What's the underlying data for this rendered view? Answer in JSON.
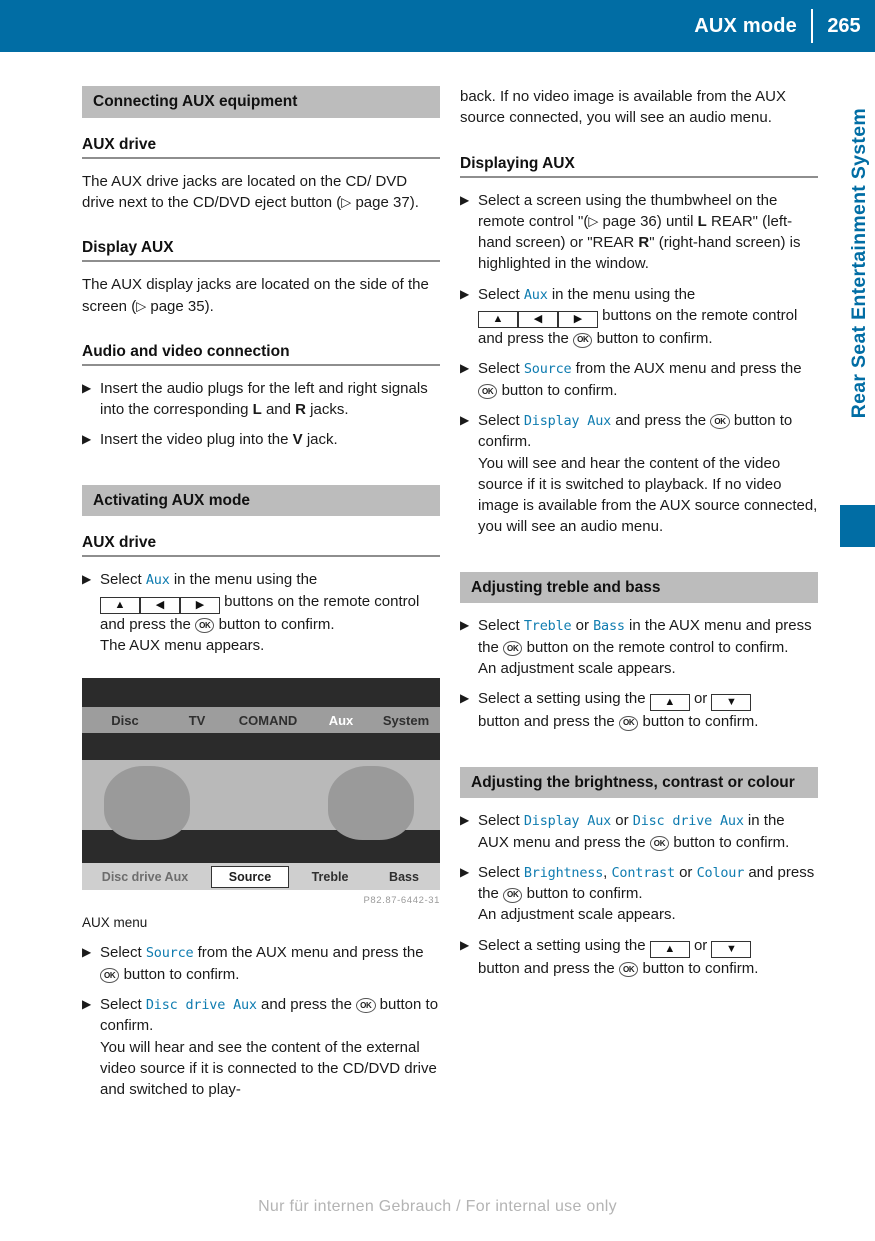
{
  "header": {
    "title": "AUX mode",
    "page_number": "265"
  },
  "sidebar": {
    "chapter_label": "Rear Seat Entertainment System"
  },
  "footer": {
    "text": "Nur für internen Gebrauch / For internal use only"
  },
  "left_column": {
    "section1_heading": "Connecting AUX equipment",
    "sub1_heading": "AUX drive",
    "sub1_para_a": "The AUX drive jacks are located on the CD/ DVD drive next to the CD/DVD eject button (",
    "sub1_para_ref": "page 37",
    "sub1_para_b": ").",
    "sub2_heading": "Display AUX",
    "sub2_para_a": "The AUX display jacks are located on the side of the screen (",
    "sub2_para_ref": "page 35",
    "sub2_para_b": ").",
    "sub3_heading": "Audio and video connection",
    "step1_a": "Insert the audio plugs for the left and right signals into the corresponding ",
    "step1_L": "L",
    "step1_b": " and ",
    "step1_R": "R",
    "step1_c": " jacks.",
    "step2_a": "Insert the video plug into the ",
    "step2_V": "V",
    "step2_b": " jack.",
    "section2_heading": "Activating AUX mode",
    "sub4_heading": "AUX drive",
    "step3_a": "Select ",
    "step3_aux": "Aux",
    "step3_b": " in the menu using the",
    "step3_c": " buttons on the remote control and press the ",
    "step3_d": " button to confirm.",
    "step3_e": "The AUX menu appears.",
    "figure": {
      "top_menu": [
        "Disc",
        "TV",
        "COMAND",
        "Aux",
        "System"
      ],
      "selected_top": "Aux",
      "bottom_menu": [
        "Disc drive Aux",
        "Source",
        "Treble",
        "Bass"
      ],
      "selected_bottom": "Source",
      "code": "P82.87-6442-31",
      "caption": "AUX menu"
    },
    "step4_a": "Select ",
    "step4_src": "Source",
    "step4_b": " from the AUX menu and press the ",
    "step4_c": " button to confirm.",
    "step5_a": "Select ",
    "step5_cmd": "Disc drive Aux",
    "step5_b": " and press the ",
    "step5_c": " button to confirm.",
    "step5_d": "You will hear and see the content of the external video source if it is connected to the CD/DVD drive and switched to play-"
  },
  "right_column": {
    "cont_para": "back. If no video image is available from the AUX source connected, you will see an audio menu.",
    "sub5_heading": "Displaying AUX",
    "step6_a": "Select a screen using the thumbwheel on the remote control \"(",
    "step6_ref": "page 36",
    "step6_b": ") until ",
    "step6_L": "L",
    "step6_c": " REAR\" (left-hand screen) or \"REAR ",
    "step6_R": "R",
    "step6_d": "\" (right-hand screen) is highlighted in the window.",
    "step7_a": "Select ",
    "step7_aux": "Aux",
    "step7_b": " in the menu using the",
    "step7_c": " buttons on the remote control and press the ",
    "step7_d": " button to confirm.",
    "step8_a": "Select ",
    "step8_src": "Source",
    "step8_b": " from the AUX menu and press the ",
    "step8_c": " button to confirm.",
    "step9_a": "Select ",
    "step9_cmd": "Display Aux",
    "step9_b": " and press the ",
    "step9_c": " button to confirm.",
    "step9_d": "You will see and hear the content of the video source if it is switched to playback. If no video image is available from the AUX source connected, you will see an audio menu.",
    "section3_heading": "Adjusting treble and bass",
    "step10_a": "Select ",
    "step10_treble": "Treble",
    "step10_b": " or ",
    "step10_bass": "Bass",
    "step10_c": " in the AUX menu and press the ",
    "step10_d": " button on the remote control to confirm.",
    "step10_e": "An adjustment scale appears.",
    "step11_a": "Select a setting using the ",
    "step11_b": " or ",
    "step11_c": " button and press the ",
    "step11_d": " button to confirm.",
    "section4_heading": "Adjusting the brightness, contrast or colour",
    "step12_a": "Select ",
    "step12_disp": "Display Aux",
    "step12_b": " or ",
    "step12_disc": "Disc drive Aux",
    "step12_c": " in the AUX menu and press the ",
    "step12_d": " button to confirm.",
    "step13_a": "Select ",
    "step13_bri": "Brightness",
    "step13_sep1": ", ",
    "step13_con": "Contrast",
    "step13_sep2": " or ",
    "step13_col": "Colour",
    "step13_b": " and press the ",
    "step13_c": " button to confirm.",
    "step13_d": "An adjustment scale appears.",
    "step14_a": "Select a setting using the ",
    "step14_b": " or ",
    "step14_c": " button and press the ",
    "step14_d": " button to confirm."
  },
  "icons": {
    "ok_label": "OK",
    "arrow_up": "▲",
    "arrow_down": "▼",
    "arrow_left": "◀",
    "arrow_right": "▶",
    "step_marker": "▶",
    "page_ref_marker": "▷"
  },
  "colors": {
    "brand_blue": "#016da4",
    "command_blue": "#0f7cb0",
    "section_grey": "#bcbcbc"
  }
}
